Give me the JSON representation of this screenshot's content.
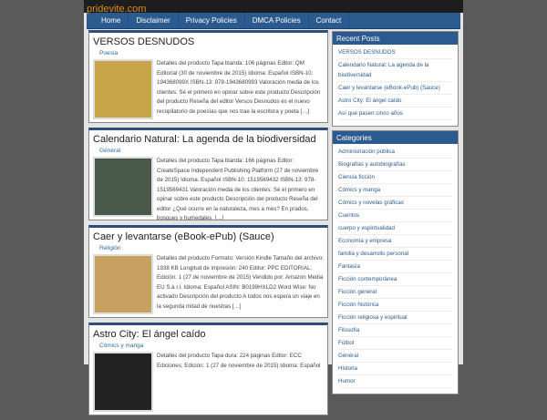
{
  "site": {
    "title": "pridevite.com"
  },
  "nav": [
    "Home",
    "Disclaimer",
    "Privacy Policies",
    "DMCA Policies",
    "Contact"
  ],
  "posts": [
    {
      "title": "VERSOS DESNUDOS",
      "category": "Poesía",
      "thumb": "#c9a54a",
      "excerpt": "Detalles del producto Tapa blanda: 106 páginas Editor: QM Editorial (30 de noviembre de 2015) Idioma: Español ISBN-10: 194368099X ISBN-13: 978-1943680993 Valoración media de los clientes: Sé el primero en opinar sobre este producto Descripción del producto Reseña del editor Versos Desnudos es el nuevo recopilatorio de poesías que nos trae la escritora y poeta […]"
    },
    {
      "title": "Calendario Natural: La agenda de la biodiversidad",
      "category": "Général",
      "thumb": "#4a5a4a",
      "excerpt": "Detalles del producto Tapa blanda: 166 páginas Editor: CreateSpace Independent Publishing Platform (27 de noviembre de 2015) Idioma: Español ISBN-10: 1519569432 ISBN-13: 978-1519569431 Valoración media de los clientes: Sé el primero en opinar sobre este producto Descripción del producto Reseña del editor ¿Qué ocurre en la naturaleza, mes a mes? En prados, bosques y humedales, […]"
    },
    {
      "title": "Caer y levantarse (eBook-ePub) (Sauce)",
      "category": "Religión",
      "thumb": "#c8a060",
      "excerpt": "Detalles del producto Formato: Versión Kindle Tamaño del archivo: 1938 KB Longitud de impresión: 240 Editor: PPC EDITORIAL; Edición: 1 (27 de noviembre de 2015) Vendido por: Amazon Media EU S.à r.l. Idioma: Español ASIN: B0199HXLD2 Word Wise: No activado Descripción del producto A todos nos espera un viaje en la segunda mitad de nuestras […]"
    },
    {
      "title": "Astro City: El ángel caído",
      "category": "Cómics y manga",
      "thumb": "#222222",
      "excerpt": "Detalles del producto Tapa dura: 224 páginas Editor: ECC Ediciones; Edición: 1 (27 de noviembre de 2015) Idioma: Español"
    }
  ],
  "recent": {
    "title": "Recent Posts",
    "items": [
      "VERSOS DESNUDOS",
      "Calendario Natural: La agenda de la biodiversidad",
      "Caer y levantarse (eBook-ePub) (Sauce)",
      "Astro City: El ángel caído",
      "Así que pasen cinco años"
    ]
  },
  "categories": {
    "title": "Categories",
    "items": [
      "Administración pública",
      "Biografías y autobiografías",
      "Ciencia ficción",
      "Cómics y manga",
      "Cómics y novelas gráficas",
      "Cuentos",
      "cuerpo y espiritualidad",
      "Economía y empresa",
      "familia y desarrollo personal",
      "Fantasía",
      "Ficción contemporánea",
      "Ficción general",
      "Ficción histórica",
      "Ficción religiosa y espiritual",
      "Filosofía",
      "Fútbol",
      "Général",
      "Historia",
      "Humor"
    ]
  }
}
